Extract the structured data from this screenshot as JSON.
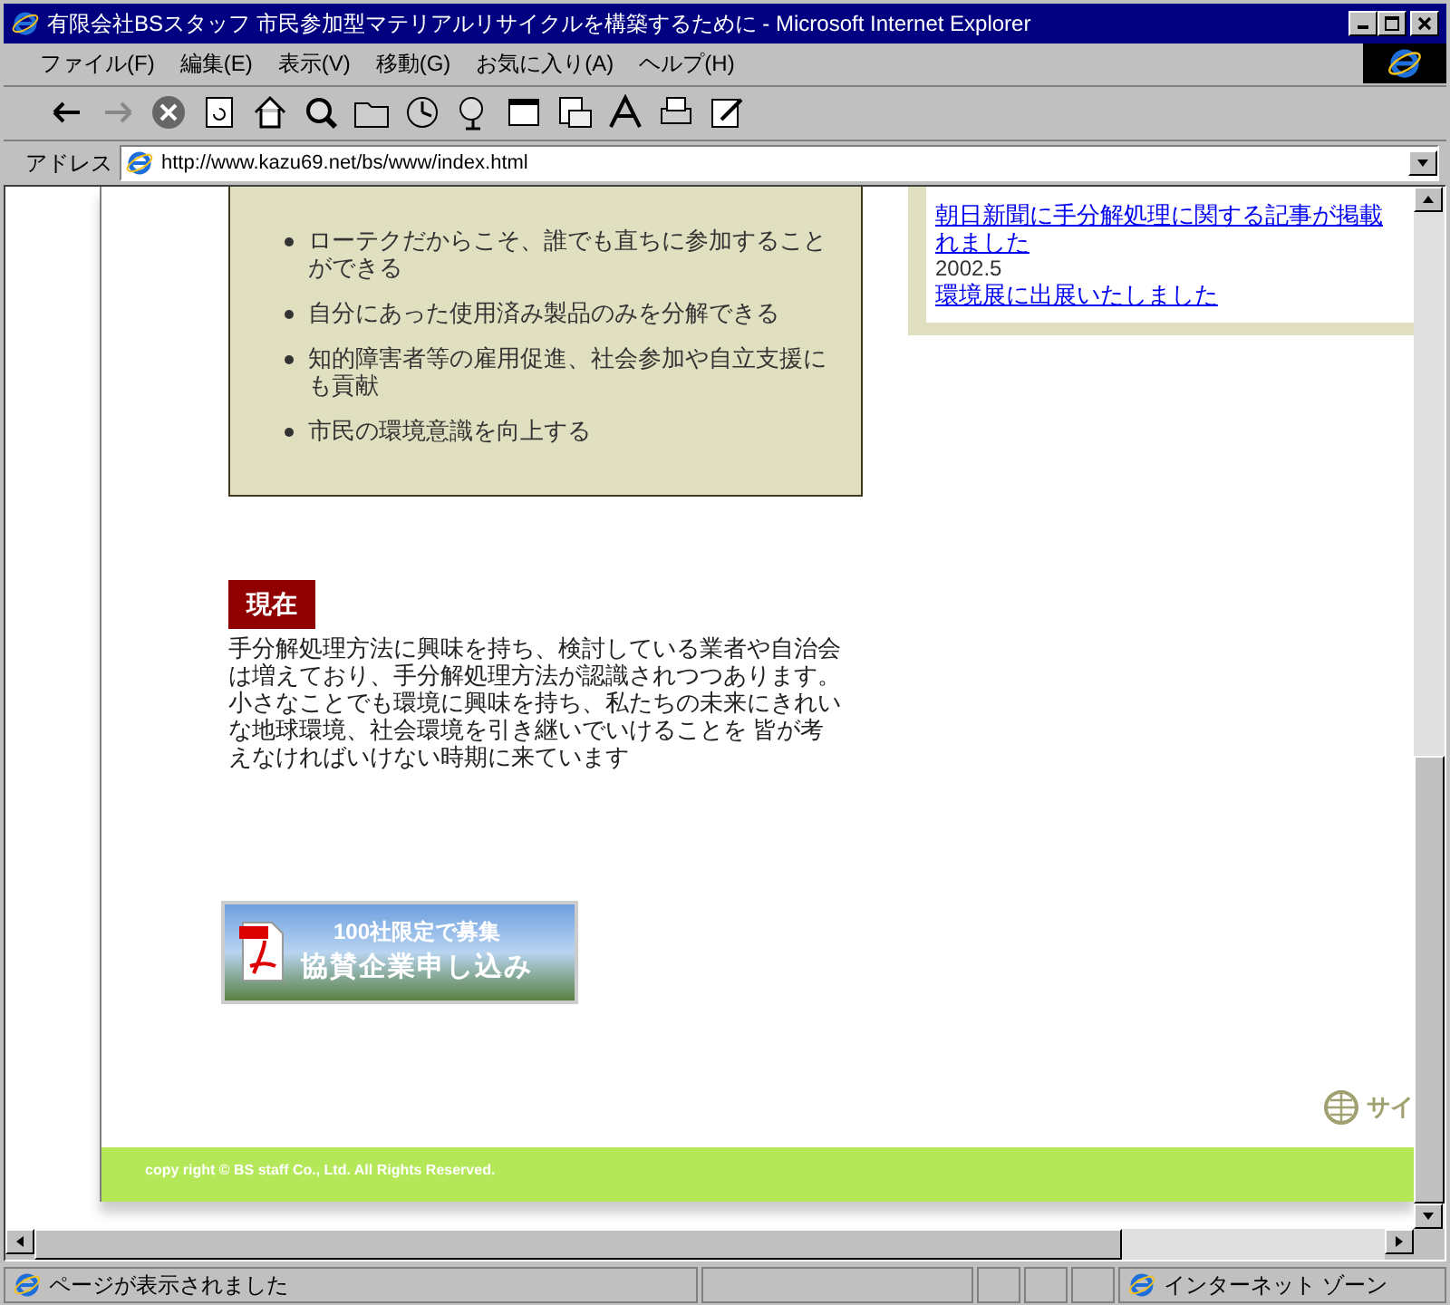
{
  "window": {
    "title": "有限会社BSスタッフ 市民参加型マテリアルリサイクルを構築するために - Microsoft Internet Explorer"
  },
  "menu": [
    "ファイル(F)",
    "編集(E)",
    "表示(V)",
    "移動(G)",
    "お気に入り(A)",
    "ヘルプ(H)"
  ],
  "address": {
    "label": "アドレス",
    "url": "http://www.kazu69.net/bs/www/index.html"
  },
  "page": {
    "features": [
      "ローテクだからこそ、誰でも直ちに参加することができる",
      "自分にあった使用済み製品のみを分解できる",
      "知的障害者等の雇用促進、社会参加や自立支援にも貢献",
      "市民の環境意識を向上する"
    ],
    "section_heading": "現在",
    "paragraph": "手分解処理方法に興味を持ち、検討している業者や自治会は増えており、手分解処理方法が認識されつつあります。小さなことでも環境に興味を持ち、私たちの未来にきれいな地球環境、社会環境を引き継いでいけることを 皆が考えなければいけない時期に来ています",
    "banner": {
      "line_1": "100社限定で募集",
      "line_2": "協賛企業申し込み"
    },
    "news": [
      {
        "lines": [
          "朝日新聞に手分解処理に関する記事が掲載",
          "れました"
        ]
      },
      {
        "date": "2002.5",
        "lines": [
          "環境展に出展いたしました"
        ]
      }
    ],
    "side_link": "サイ",
    "copyright": "copy right © BS staff Co., Ltd. All Rights Reserved."
  },
  "status_bar": {
    "text": "ページが表示されました",
    "zone": "インターネット ゾーン"
  }
}
